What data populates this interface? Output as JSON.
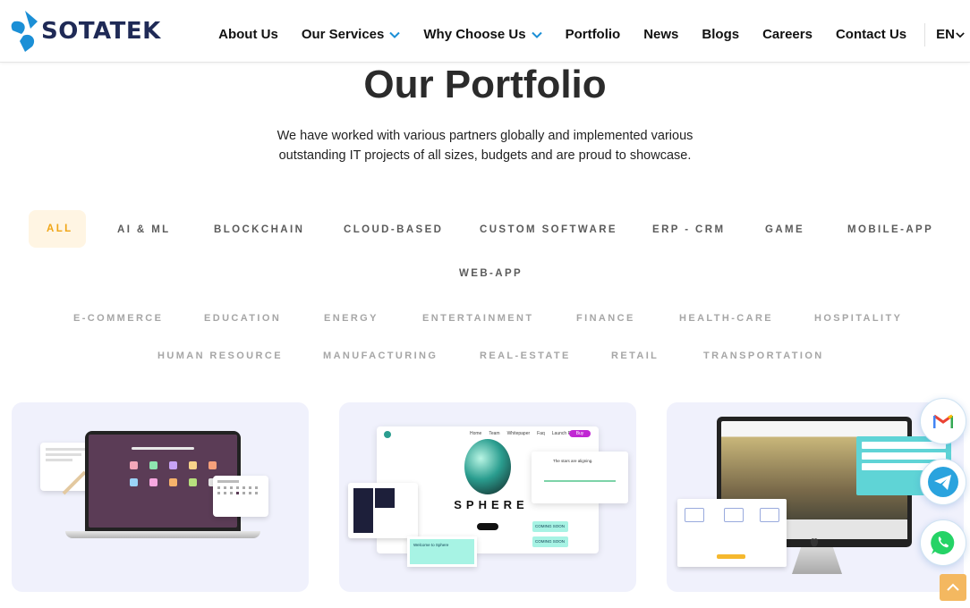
{
  "brand": {
    "name": "SOTATEK"
  },
  "nav": {
    "items": [
      {
        "label": "About Us"
      },
      {
        "label": "Our Services"
      },
      {
        "label": "Why Choose Us"
      },
      {
        "label": "Portfolio"
      },
      {
        "label": "News"
      },
      {
        "label": "Blogs"
      },
      {
        "label": "Careers"
      },
      {
        "label": "Contact Us"
      }
    ],
    "language": "EN"
  },
  "portfolio": {
    "title": "Our Portfolio",
    "description": "We have worked with various partners globally and implemented various outstanding IT projects of all sizes, budgets and are proud to showcase."
  },
  "filters": {
    "categories": [
      "ALL",
      "AI & ML",
      "BLOCKCHAIN",
      "CLOUD-BASED",
      "CUSTOM SOFTWARE",
      "ERP - CRM",
      "GAME",
      "MOBILE-APP",
      "WEB-APP"
    ],
    "industries": [
      "E-COMMERCE",
      "EDUCATION",
      "ENERGY",
      "ENTERTAINMENT",
      "FINANCE",
      "HEALTH-CARE",
      "HOSPITALITY",
      "HUMAN RESOURCE",
      "MANUFACTURING",
      "REAL-ESTATE",
      "RETAIL",
      "TRANSPORTATION"
    ],
    "active": "ALL"
  },
  "cards": {
    "sphere": {
      "brand": "SPHERE",
      "menu": [
        "Home",
        "Team",
        "Whitepaper",
        "Faq",
        "Launch Project"
      ],
      "cta": "Buy",
      "stars_text": "The stars are aligning.",
      "coming_soon": "COMING SOON",
      "welcome": "Welcome to Sphere"
    }
  },
  "floating": [
    "gmail-icon",
    "telegram-icon",
    "whatsapp-icon"
  ],
  "colors": {
    "accent": "#f0a617",
    "brand": "#1f2a56",
    "logo_blue": "#1b8fd6",
    "card_bg": "#f0f1fc"
  }
}
